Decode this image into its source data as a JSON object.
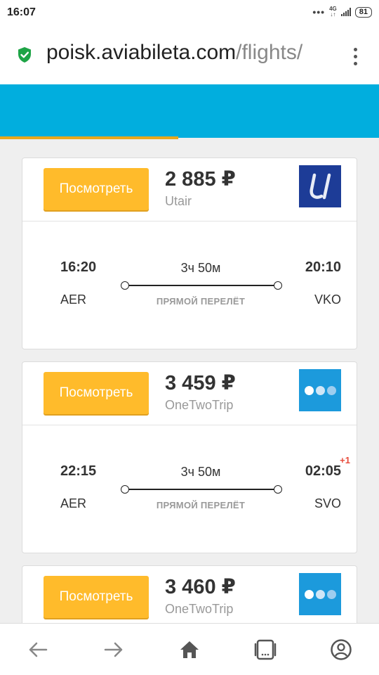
{
  "status": {
    "time": "16:07",
    "network": "4G",
    "battery": "81"
  },
  "browser": {
    "url_domain": "poisk.aviabileta.com",
    "url_path": "/flights/"
  },
  "colors": {
    "banner": "#01aede",
    "button": "#ffbb2b",
    "accent_bar": "#e8a81c"
  },
  "flights": [
    {
      "button_label": "Посмотреть",
      "price": "2 885 ₽",
      "agency": "Utair",
      "logo": "utair-logo",
      "dep_time": "16:20",
      "arr_time": "20:10",
      "duration": "3ч 50м",
      "dep_code": "AER",
      "arr_code": "VKO",
      "direct_label": "ПРЯМОЙ ПЕРЕЛЁТ",
      "day_offset": ""
    },
    {
      "button_label": "Посмотреть",
      "price": "3 459 ₽",
      "agency": "OneTwoTrip",
      "logo": "onetwotrip-logo",
      "dep_time": "22:15",
      "arr_time": "02:05",
      "duration": "3ч 50м",
      "dep_code": "AER",
      "arr_code": "SVO",
      "direct_label": "ПРЯМОЙ ПЕРЕЛЁТ",
      "day_offset": "+1"
    },
    {
      "button_label": "Посмотреть",
      "price": "3 460 ₽",
      "agency": "OneTwoTrip",
      "logo": "onetwotrip-logo"
    }
  ],
  "nav": [
    "back-icon",
    "forward-icon",
    "home-icon",
    "tabs-icon",
    "account-icon"
  ]
}
